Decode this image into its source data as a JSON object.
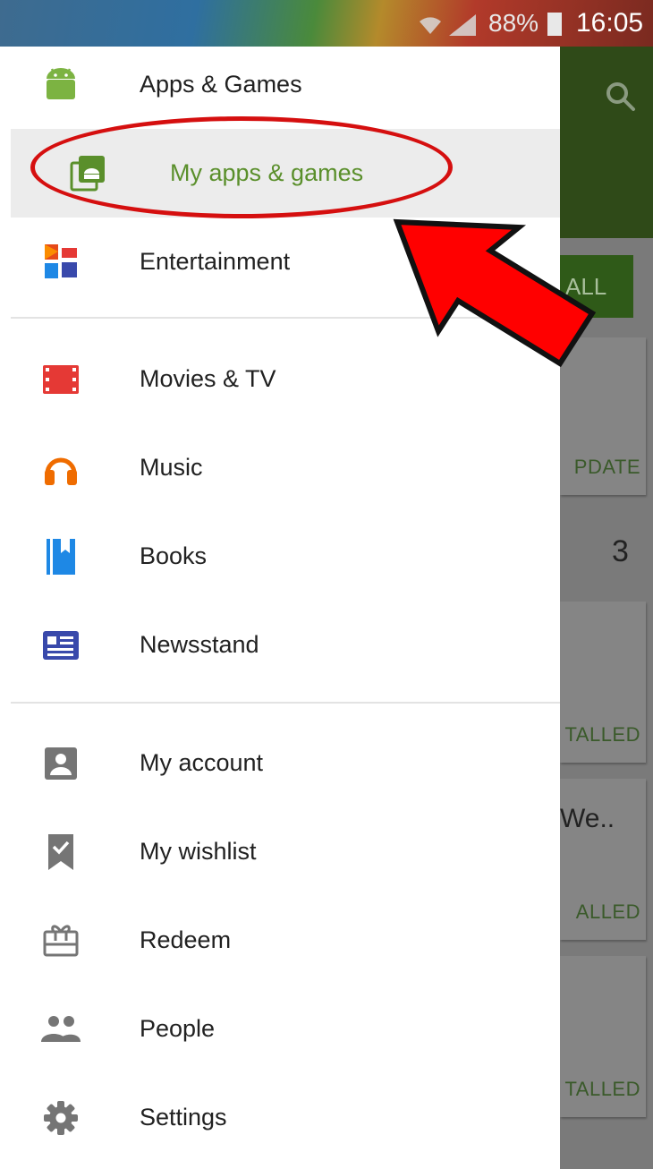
{
  "status_bar": {
    "battery_percent": "88%",
    "time": "16:05"
  },
  "drawer": {
    "sections": [
      {
        "items": [
          {
            "label": "Apps & Games",
            "icon": "android-icon",
            "color": "#7cb342"
          },
          {
            "label": "My apps & games",
            "icon": "my-apps-icon",
            "color": "#5a8f2b",
            "selected": true
          },
          {
            "label": "Entertainment",
            "icon": "entertainment-icon"
          }
        ]
      },
      {
        "items": [
          {
            "label": "Movies & TV",
            "icon": "film-icon",
            "color": "#e53935"
          },
          {
            "label": "Music",
            "icon": "headphones-icon",
            "color": "#ef6c00"
          },
          {
            "label": "Books",
            "icon": "book-icon",
            "color": "#1e88e5"
          },
          {
            "label": "Newsstand",
            "icon": "newsstand-icon",
            "color": "#3949ab"
          }
        ]
      },
      {
        "items": [
          {
            "label": "My account",
            "icon": "account-icon",
            "color": "#757575"
          },
          {
            "label": "My wishlist",
            "icon": "wishlist-icon",
            "color": "#757575"
          },
          {
            "label": "Redeem",
            "icon": "gift-card-icon",
            "color": "#757575"
          },
          {
            "label": "People",
            "icon": "people-icon",
            "color": "#757575"
          },
          {
            "label": "Settings",
            "icon": "gear-icon",
            "color": "#757575"
          }
        ]
      }
    ]
  },
  "background_app": {
    "install_button": "ALL",
    "update_label": "PDATE",
    "count": "3",
    "installed_labels": [
      "TALLED",
      "ALLED",
      "TALLED"
    ],
    "truncated_title": "We.."
  },
  "annotation": {
    "highlight_color": "#d50f0f"
  }
}
